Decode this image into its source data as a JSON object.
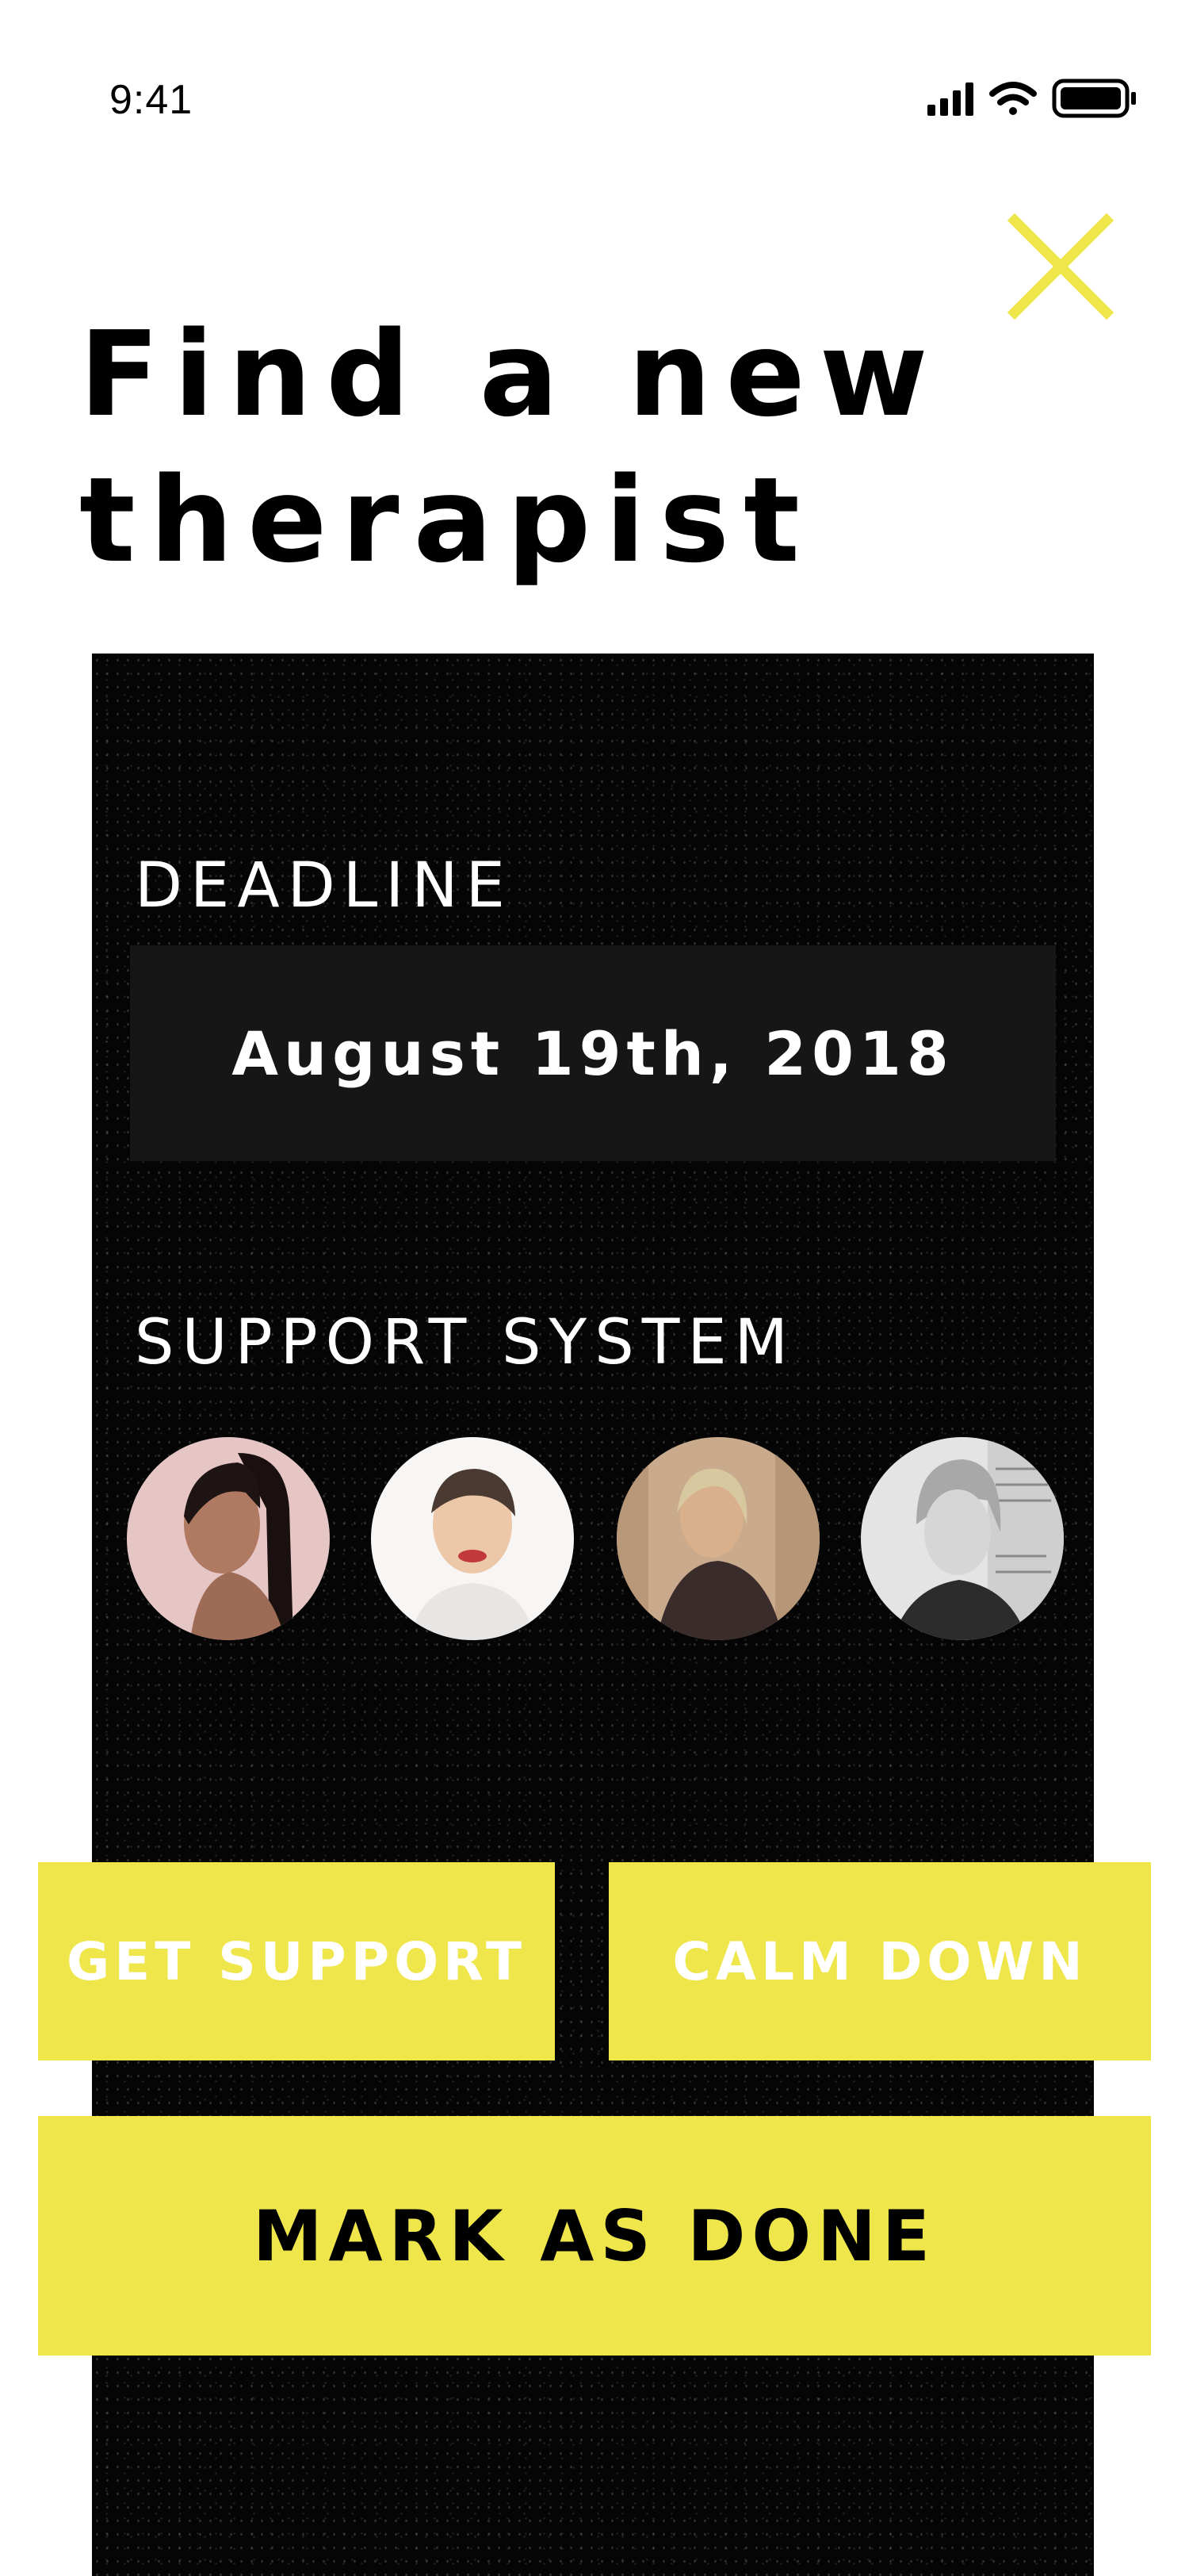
{
  "status_bar": {
    "time": "9:41",
    "icons": [
      "cellular-signal-icon",
      "wifi-icon",
      "battery-icon"
    ]
  },
  "header": {
    "close_icon": "close-icon",
    "title": "Find a new therapist"
  },
  "task": {
    "deadline_label": "DEADLINE",
    "deadline_value": "August 19th, 2018",
    "support_label": "SUPPORT SYSTEM",
    "support_avatars": [
      "avatar-1",
      "avatar-2",
      "avatar-3",
      "avatar-4"
    ]
  },
  "actions": {
    "get_support": "GET SUPPORT",
    "calm_down": "CALM DOWN",
    "mark_as_done": "MARK AS DONE"
  },
  "colors": {
    "accent": "#efe64b",
    "panel_background": "#050505",
    "deadline_box": "#161616",
    "title_text": "#000000"
  }
}
